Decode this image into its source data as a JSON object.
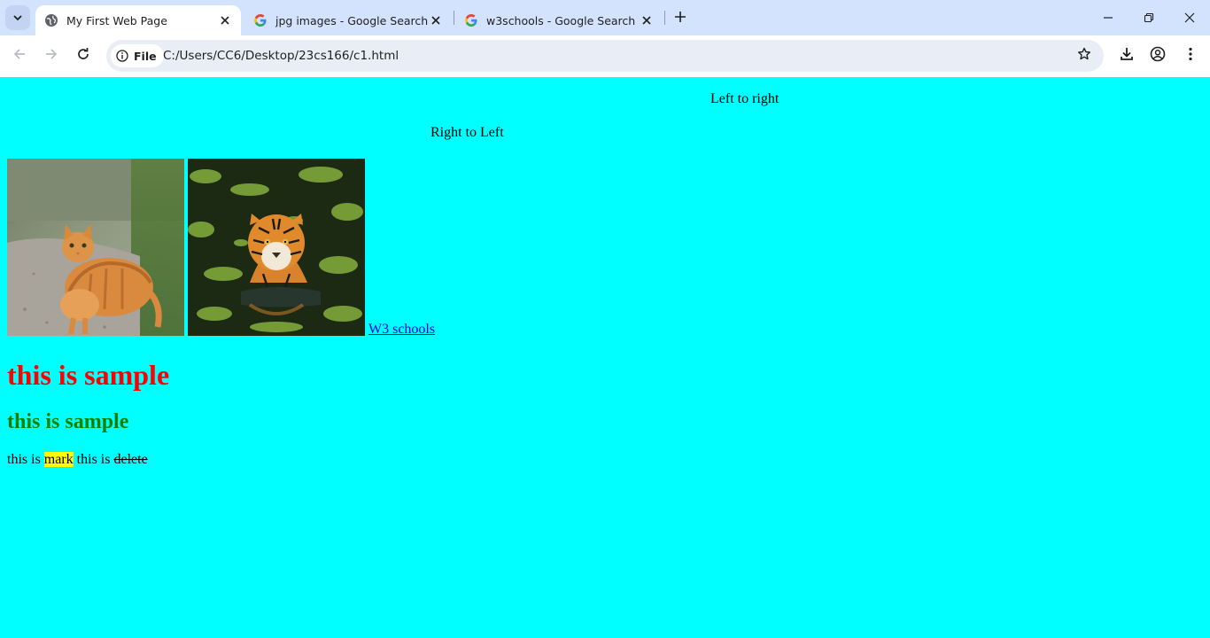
{
  "browser": {
    "tabs": [
      {
        "title": "My First Web Page",
        "icon": "globe-icon",
        "active": true
      },
      {
        "title": "jpg images - Google Search",
        "icon": "google-icon",
        "active": false
      },
      {
        "title": "w3schools - Google Search",
        "icon": "google-icon",
        "active": false
      }
    ],
    "address": {
      "chip_label": "File",
      "url": "C:/Users/CC6/Desktop/23cs166/c1.html"
    }
  },
  "page": {
    "background": "#00ffff",
    "marquee_ltr": "Left to right",
    "marquee_rtl": "Right to Left",
    "images": [
      {
        "subject": "orange tabby cat sitting on gravel path"
      },
      {
        "subject": "tiger wading in green water"
      }
    ],
    "link_text": "W3 schools",
    "heading1": {
      "text": "this is sample",
      "color": "#ff0000"
    },
    "heading2": {
      "text": "this is sample",
      "color": "#008000"
    },
    "paragraph": {
      "prefix": "this is ",
      "mark": "mark",
      "middle": " this is ",
      "deleted": "delete"
    }
  }
}
